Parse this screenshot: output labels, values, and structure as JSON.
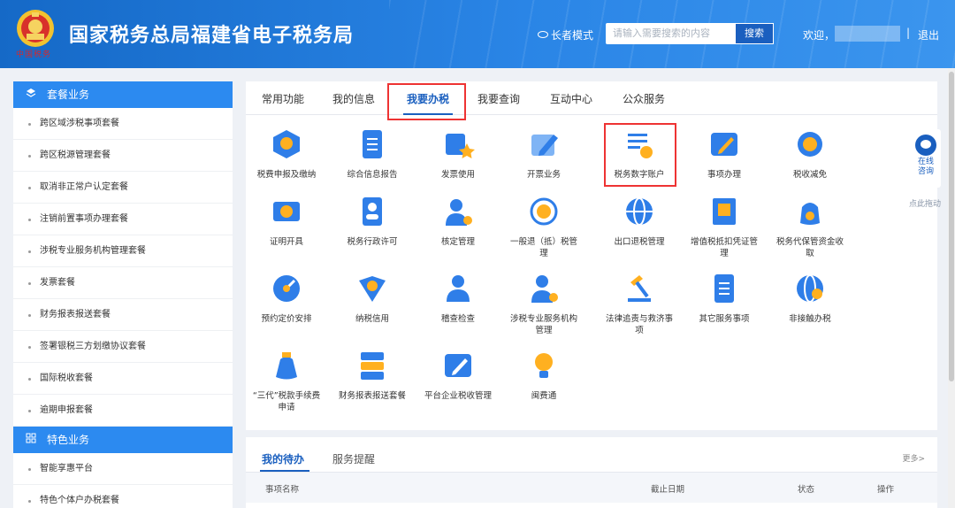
{
  "header": {
    "site_title": "国家税务总局福建省电子税务局",
    "emblem_caption": "中国税务",
    "elder_mode": "长者模式",
    "search_placeholder": "请输入需要搜索的内容",
    "search_button": "搜索",
    "welcome": "欢迎，",
    "separator": "|",
    "logout": "退出"
  },
  "sidebar": {
    "section1": {
      "title": "套餐业务",
      "icon": "layers-icon"
    },
    "items1": [
      "跨区域涉税事项套餐",
      "跨区税源管理套餐",
      "取消非正常户认定套餐",
      "注销前置事项办理套餐",
      "涉税专业服务机构管理套餐",
      "发票套餐",
      "财务报表报送套餐",
      "签署银税三方划缴协议套餐",
      "国际税收套餐",
      "逾期申报套餐"
    ],
    "section2": {
      "title": "特色业务",
      "icon": "grid-icon"
    },
    "items2": [
      "智能享惠平台",
      "特色个体户办税套餐"
    ]
  },
  "tabs": [
    "常用功能",
    "我的信息",
    "我要办税",
    "我要查询",
    "互动中心",
    "公众服务"
  ],
  "active_tab": "我要办税",
  "functions": [
    {
      "label": "税费申报及缴纳",
      "icon": "tax-declare-icon"
    },
    {
      "label": "综合信息报告",
      "icon": "report-icon"
    },
    {
      "label": "发票使用",
      "icon": "invoice-icon"
    },
    {
      "label": "开票业务",
      "icon": "issue-invoice-icon"
    },
    {
      "label": "税务数字账户",
      "icon": "digital-account-icon"
    },
    {
      "label": "事项办理",
      "icon": "matter-icon"
    },
    {
      "label": "税收减免",
      "icon": "tax-relief-icon"
    },
    {
      "label": "证明开具",
      "icon": "certificate-icon"
    },
    {
      "label": "税务行政许可",
      "icon": "admin-permit-icon"
    },
    {
      "label": "核定管理",
      "icon": "verify-manage-icon"
    },
    {
      "label": "一般退（抵）税管理",
      "icon": "refund-icon"
    },
    {
      "label": "出口退税管理",
      "icon": "export-refund-icon"
    },
    {
      "label": "增值税抵扣凭证管理",
      "icon": "vat-deduct-icon"
    },
    {
      "label": "税务代保管资金收取",
      "icon": "custody-fund-icon"
    },
    {
      "label": "预约定价安排",
      "icon": "pricing-icon"
    },
    {
      "label": "纳税信用",
      "icon": "credit-icon"
    },
    {
      "label": "稽查检查",
      "icon": "inspection-icon"
    },
    {
      "label": "涉税专业服务机构管理",
      "icon": "agency-manage-icon"
    },
    {
      "label": "法律追责与救济事项",
      "icon": "gavel-icon"
    },
    {
      "label": "其它服务事项",
      "icon": "other-services-icon"
    },
    {
      "label": "非接触办税",
      "icon": "contactless-icon"
    },
    {
      "label": "“三代”税款手续费申请",
      "icon": "fee-bag-icon"
    },
    {
      "label": "财务报表报送套餐",
      "icon": "stack-icon"
    },
    {
      "label": "平台企业税收管理",
      "icon": "platform-icon"
    },
    {
      "label": "闽费通",
      "icon": "lightbulb-icon"
    }
  ],
  "float": {
    "line1": "在线",
    "line2": "咨询",
    "drag_hint": "点此拖动"
  },
  "todo": {
    "tabs": [
      "我的待办",
      "服务提醒"
    ],
    "more": "更多>",
    "columns": [
      "事项名称",
      "截止日期",
      "状态",
      "操作"
    ]
  },
  "colors": {
    "primary": "#1a5fbf",
    "header_start": "#1569c7",
    "header_end": "#3b95ee",
    "highlight_border": "#ee3333",
    "icon_blue": "#2f7ee8",
    "icon_accent": "#ffb020"
  }
}
